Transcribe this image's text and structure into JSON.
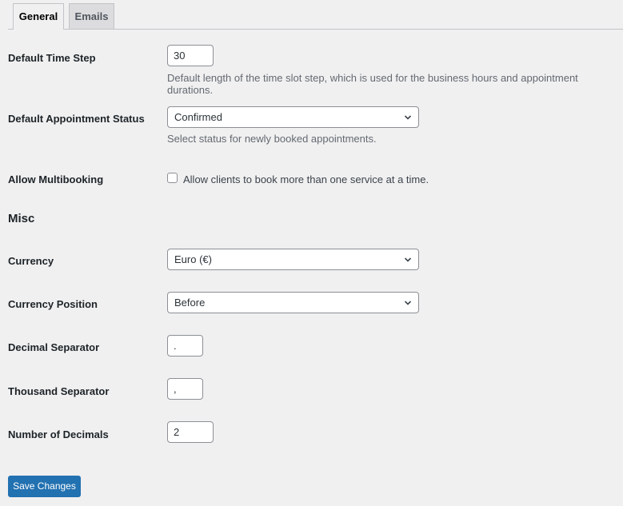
{
  "tabs": [
    {
      "label": "General",
      "active": true
    },
    {
      "label": "Emails",
      "active": false
    }
  ],
  "general": {
    "time_step": {
      "label": "Default Time Step",
      "value": "30",
      "description": "Default length of the time slot step, which is used for the business hours and appointment durations."
    },
    "appointment_status": {
      "label": "Default Appointment Status",
      "value": "Confirmed",
      "description": "Select status for newly booked appointments."
    },
    "multibooking": {
      "label": "Allow Multibooking",
      "checked": false,
      "checkbox_label": "Allow clients to book more than one service at a time."
    }
  },
  "misc": {
    "title": "Misc",
    "currency": {
      "label": "Currency",
      "value": "Euro (€)"
    },
    "currency_position": {
      "label": "Currency Position",
      "value": "Before"
    },
    "decimal_separator": {
      "label": "Decimal Separator",
      "value": "."
    },
    "thousand_separator": {
      "label": "Thousand Separator",
      "value": ","
    },
    "number_of_decimals": {
      "label": "Number of Decimals",
      "value": "2"
    }
  },
  "save_button": {
    "label": "Save Changes"
  },
  "colors": {
    "primary": "#2271b1",
    "background": "#f0f0f1"
  }
}
